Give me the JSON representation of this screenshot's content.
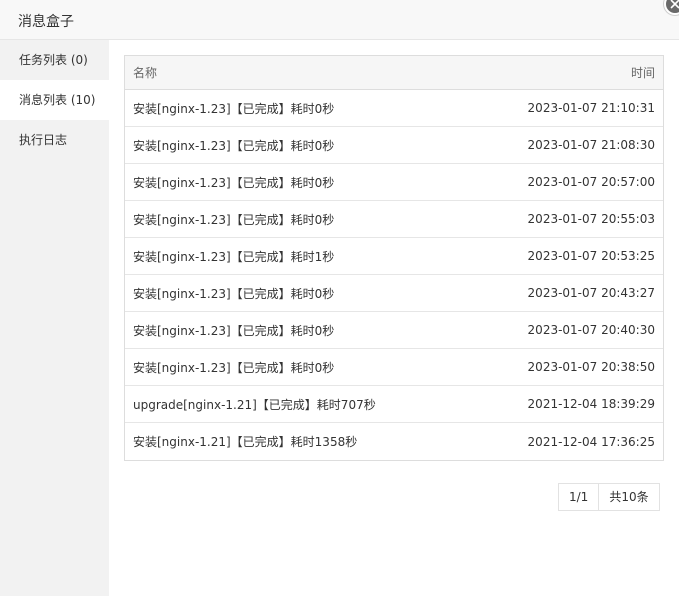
{
  "window": {
    "title": "消息盒子"
  },
  "sidebar": {
    "items": [
      {
        "label": "任务列表 (0)"
      },
      {
        "label": "消息列表 (10)"
      },
      {
        "label": "执行日志"
      }
    ]
  },
  "table": {
    "headers": {
      "name": "名称",
      "time": "时间"
    },
    "rows": [
      {
        "name": "安装[nginx-1.23]【已完成】耗时0秒",
        "time": "2023-01-07 21:10:31"
      },
      {
        "name": "安装[nginx-1.23]【已完成】耗时0秒",
        "time": "2023-01-07 21:08:30"
      },
      {
        "name": "安装[nginx-1.23]【已完成】耗时0秒",
        "time": "2023-01-07 20:57:00"
      },
      {
        "name": "安装[nginx-1.23]【已完成】耗时0秒",
        "time": "2023-01-07 20:55:03"
      },
      {
        "name": "安装[nginx-1.23]【已完成】耗时1秒",
        "time": "2023-01-07 20:53:25"
      },
      {
        "name": "安装[nginx-1.23]【已完成】耗时0秒",
        "time": "2023-01-07 20:43:27"
      },
      {
        "name": "安装[nginx-1.23]【已完成】耗时0秒",
        "time": "2023-01-07 20:40:30"
      },
      {
        "name": "安装[nginx-1.23]【已完成】耗时0秒",
        "time": "2023-01-07 20:38:50"
      },
      {
        "name": "upgrade[nginx-1.21]【已完成】耗时707秒",
        "time": "2021-12-04 18:39:29"
      },
      {
        "name": "安装[nginx-1.21]【已完成】耗时1358秒",
        "time": "2021-12-04 17:36:25"
      }
    ]
  },
  "pager": {
    "page": "1/1",
    "total": "共10条"
  },
  "icons": {
    "close": "close-icon"
  },
  "colors": {
    "sidebar_bg": "#f2f2f2",
    "close_button": "#6a6a6a"
  }
}
